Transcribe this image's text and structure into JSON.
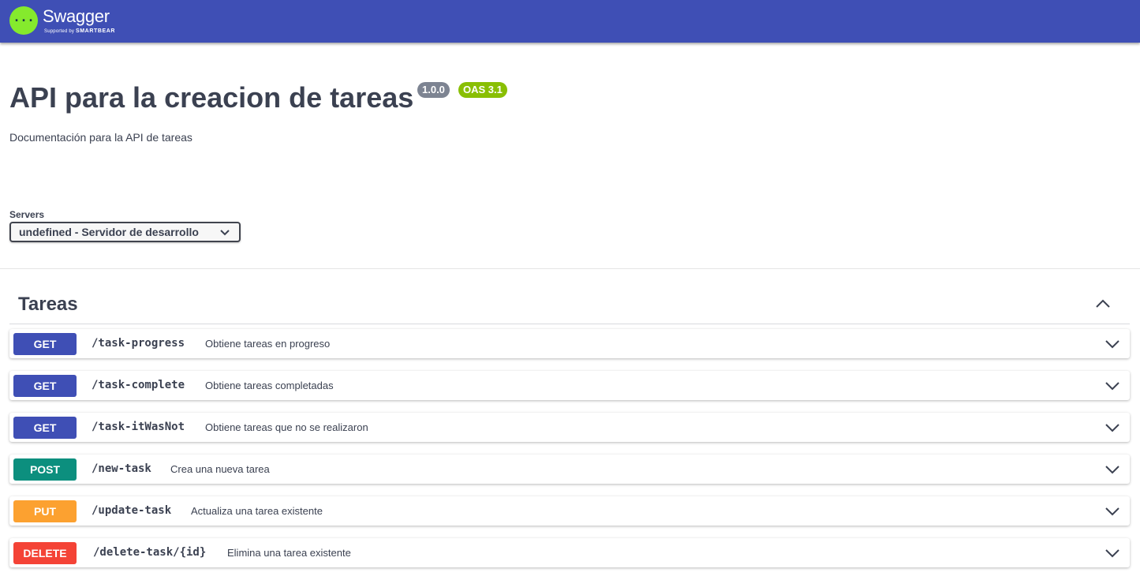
{
  "header": {
    "logo_name": "Swagger",
    "logo_sub_prefix": "Supported by",
    "logo_sub_brand": "SMARTBEAR",
    "logo_icon": "swagger-braces-icon",
    "brand_color": "#3f4fb5"
  },
  "info": {
    "title": "API para la creacion de tareas",
    "version": "1.0.0",
    "oas": "OAS 3.1",
    "description": "Documentación para la API de tareas"
  },
  "servers": {
    "label": "Servers",
    "selected": "undefined - Servidor de desarrollo"
  },
  "tag": {
    "name": "Tareas",
    "expanded": true
  },
  "operations": [
    {
      "method": "GET",
      "path": "/task-progress",
      "summary": "Obtiene tareas en progreso"
    },
    {
      "method": "GET",
      "path": "/task-complete",
      "summary": "Obtiene tareas completadas"
    },
    {
      "method": "GET",
      "path": "/task-itWasNot",
      "summary": "Obtiene tareas que no se realizaron"
    },
    {
      "method": "POST",
      "path": "/new-task",
      "summary": "Crea una nueva tarea"
    },
    {
      "method": "PUT",
      "path": "/update-task",
      "summary": "Actualiza una tarea existente"
    },
    {
      "method": "DELETE",
      "path": "/delete-task/{id}",
      "summary": "Elimina una tarea existente"
    }
  ],
  "method_colors": {
    "GET": "#3f4fb5",
    "POST": "#0c8f7e",
    "PUT": "#fca130",
    "DELETE": "#f44336"
  }
}
